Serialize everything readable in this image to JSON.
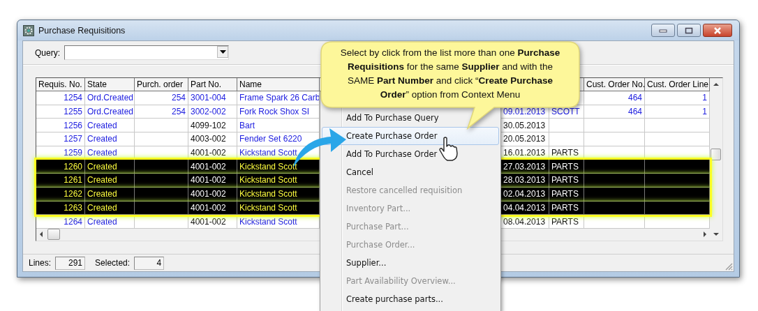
{
  "window": {
    "title": "Purchase Requisitions"
  },
  "query": {
    "label": "Query:"
  },
  "table": {
    "columns": [
      {
        "label": "Requis. No."
      },
      {
        "label": "State"
      },
      {
        "label": "Purch. order"
      },
      {
        "label": "Part No."
      },
      {
        "label": "Name"
      },
      {
        "label": "Cust. Order No."
      },
      {
        "label": "Cust. Order Line"
      }
    ],
    "rows": [
      {
        "req": "1254",
        "state": "Ord.Created",
        "po": "254",
        "part": "3001-004",
        "name": "Frame Spark 26 Carb",
        "cust_no": "464",
        "cust_line": "1",
        "kind": "ordered",
        "selected": false
      },
      {
        "req": "1255",
        "state": "Ord.Created",
        "po": "254",
        "part": "3002-002",
        "name": "Fork Rock Shox SI",
        "date": "09.01.2013",
        "supplier": "SCOTT",
        "cust_no": "464",
        "cust_line": "1",
        "kind": "ordered",
        "selected": false
      },
      {
        "req": "1256",
        "state": "Created",
        "part": "4099-102",
        "name": "Bart",
        "date": "30.05.2013",
        "kind": "created",
        "selected": false
      },
      {
        "req": "1257",
        "state": "Created",
        "part": "4003-002",
        "name": "Fender Set 6220",
        "date": "20.05.2013",
        "kind": "created",
        "selected": false
      },
      {
        "req": "1259",
        "state": "Created",
        "part": "4001-002",
        "name": "Kickstand Scott",
        "date": "16.01.2013",
        "supplier": "PARTS",
        "kind": "created",
        "selected": false
      },
      {
        "req": "1260",
        "state": "Created",
        "part": "4001-002",
        "name": "Kickstand Scott",
        "date": "27.03.2013",
        "supplier": "PARTS",
        "kind": "created",
        "selected": true
      },
      {
        "req": "1261",
        "state": "Created",
        "part": "4001-002",
        "name": "Kickstand Scott",
        "date": "28.03.2013",
        "supplier": "PARTS",
        "kind": "created",
        "selected": true
      },
      {
        "req": "1262",
        "state": "Created",
        "part": "4001-002",
        "name": "Kickstand Scott",
        "date": "02.04.2013",
        "supplier": "PARTS",
        "kind": "created",
        "selected": true
      },
      {
        "req": "1263",
        "state": "Created",
        "part": "4001-002",
        "name": "Kickstand Scott",
        "date": "04.04.2013",
        "supplier": "PARTS",
        "kind": "created",
        "selected": true
      },
      {
        "req": "1264",
        "state": "Created",
        "part": "4001-002",
        "name": "Kickstand Scott",
        "date": "08.04.2013",
        "supplier": "PARTS",
        "kind": "created",
        "selected": false
      }
    ]
  },
  "status_bar": {
    "lines_label": "Lines:",
    "lines": "291",
    "selected_label": "Selected:",
    "selected": "4"
  },
  "context_menu": {
    "items": [
      {
        "label": "Add To Purchase Query",
        "disabled": false,
        "selected": false
      },
      {
        "label": "Create Purchase Order",
        "disabled": false,
        "selected": true
      },
      {
        "label": "Add To Purchase Order",
        "disabled": false,
        "selected": false
      },
      {
        "label": "Cancel",
        "disabled": false,
        "selected": false
      },
      {
        "label": "Restore cancelled requisition",
        "disabled": true,
        "selected": false
      },
      {
        "label": "Inventory Part...",
        "disabled": true,
        "selected": false
      },
      {
        "label": "Purchase Part...",
        "disabled": true,
        "selected": false
      },
      {
        "label": "Purchase Order...",
        "disabled": true,
        "selected": false
      },
      {
        "label": "Supplier...",
        "disabled": false,
        "selected": false
      },
      {
        "label": "Part Availability Overview...",
        "disabled": true,
        "selected": false
      },
      {
        "label": "Create purchase parts...",
        "disabled": false,
        "selected": false
      }
    ]
  },
  "callout": {
    "text": "Select by click from the list more than one **Purchase Requisitions** for the same **Supplier** and with the SAME **Part Number** and click “**Create Purchase Order**” option from Context Menu"
  }
}
